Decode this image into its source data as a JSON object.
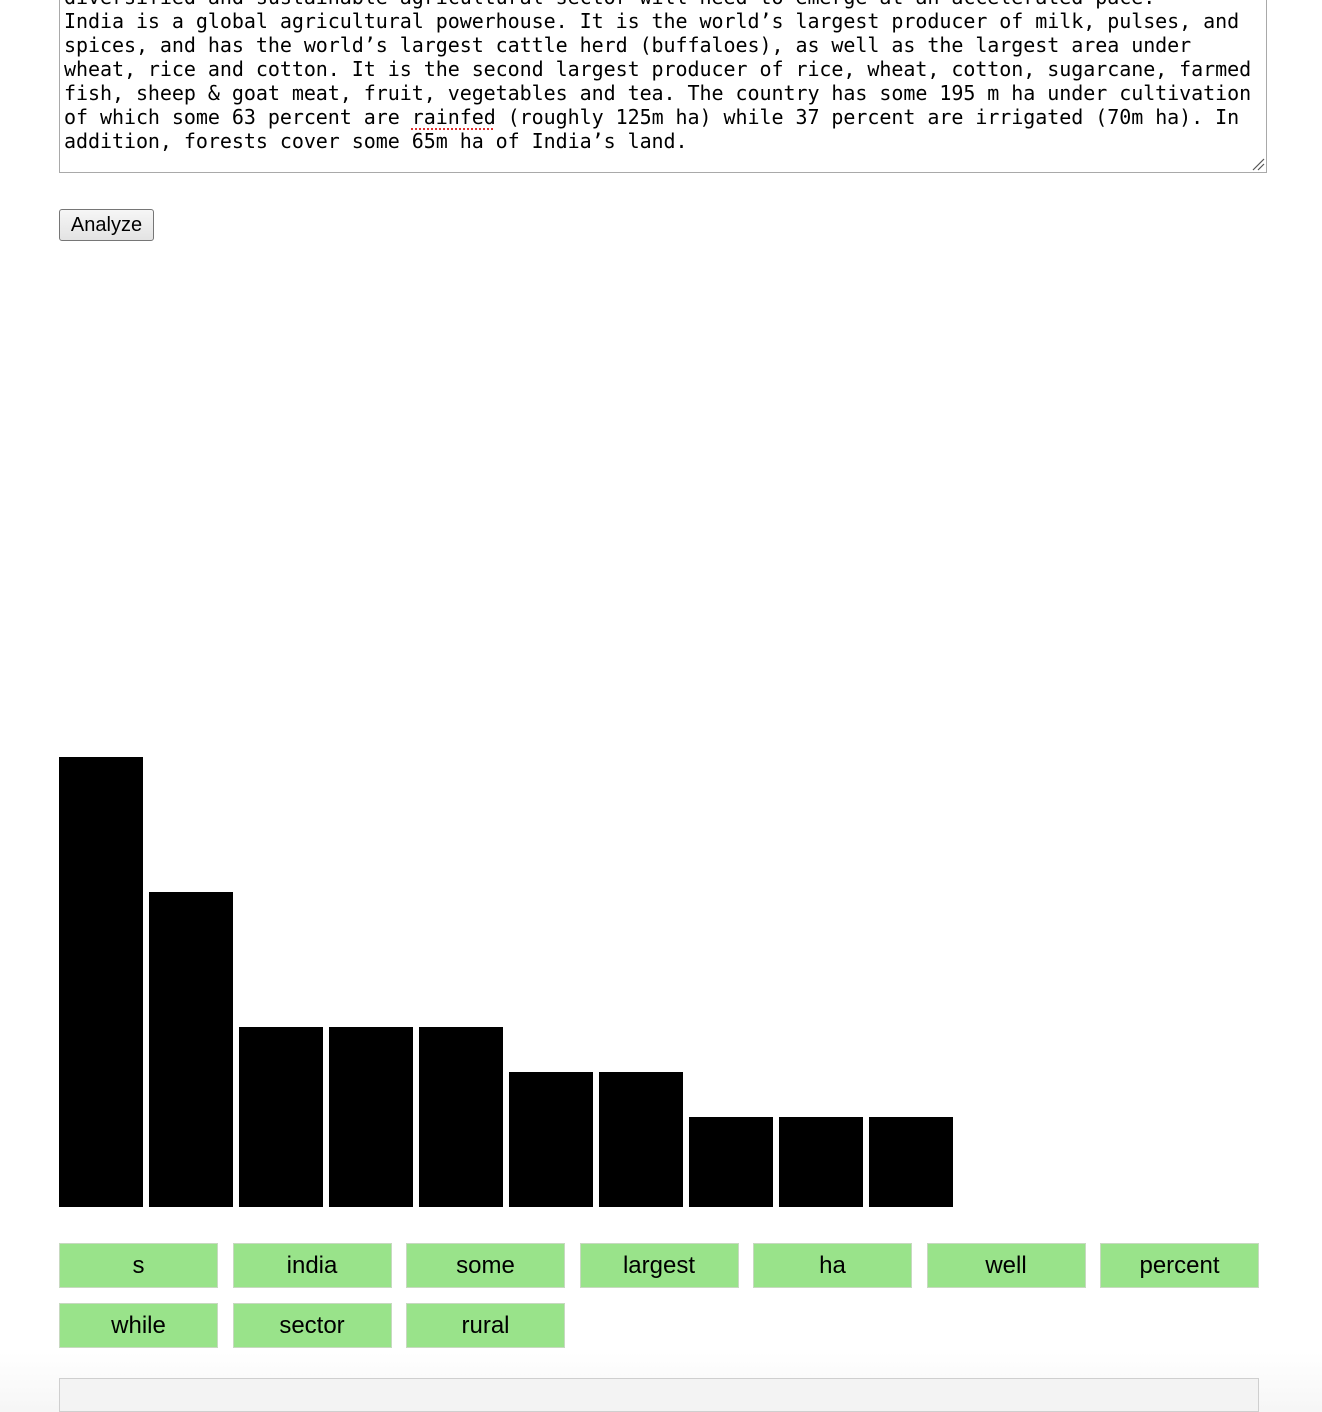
{
  "input": {
    "lines": [
      "diversified and sustainable agricultural sector will need to emerge at an accelerated pace.",
      "India is a global agricultural powerhouse. It is the world’s largest producer of milk, pulses, and",
      "spices, and has the world’s largest cattle herd (buffaloes), as well as the largest area under",
      "wheat, rice and cotton. It is the second largest producer of rice, wheat, cotton, sugarcane, farmed",
      "fish, sheep & goat meat, fruit, vegetables and tea. The country has some 195 m ha under cultivation",
      "of which some 63 percent are ",
      "addition, forests cover some 65m ha of India’s land."
    ],
    "line6_flagged_word": "rainfed",
    "line6_rest": " (roughly 125m ha) while 37 percent are irrigated (70m ha). In"
  },
  "controls": {
    "analyze_label": "Analyze"
  },
  "chart_data": {
    "type": "bar",
    "values": [
      10,
      7,
      4,
      4,
      4,
      3,
      3,
      2,
      2,
      2
    ],
    "ylim": [
      0,
      10
    ],
    "grid": false,
    "bar_color": "#000000"
  },
  "words": [
    "s",
    "india",
    "some",
    "largest",
    "ha",
    "well",
    "percent",
    "while",
    "sector",
    "rural"
  ],
  "colors": {
    "chip_bg": "#99e38a",
    "bar": "#000000"
  }
}
